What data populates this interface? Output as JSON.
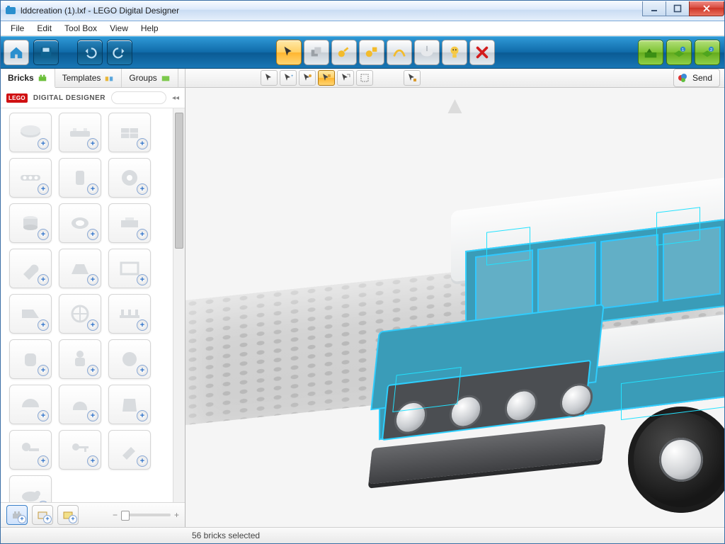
{
  "window": {
    "title": "lddcreation (1).lxf - LEGO Digital Designer"
  },
  "menu": {
    "file": "File",
    "edit": "Edit",
    "toolbox": "Tool Box",
    "view": "View",
    "help": "Help"
  },
  "cmdbar": {
    "home": "home-icon",
    "save": "save-icon",
    "undo": "undo-icon",
    "redo": "redo-icon",
    "tools": [
      "cursor",
      "clone",
      "hinge",
      "hinge-align",
      "flex",
      "paint",
      "hide",
      "delete"
    ],
    "right": [
      "landscape",
      "box-1",
      "box-2"
    ]
  },
  "tabs": {
    "bricks": "Bricks",
    "templates": "Templates",
    "groups": "Groups"
  },
  "subtools": {
    "row1": [
      "select",
      "select-add",
      "select-color",
      "select-connected",
      "select-type",
      "select-all"
    ],
    "row2": [
      "select-invert"
    ]
  },
  "send": {
    "label": "Send"
  },
  "ldd_header": {
    "logo": "LEGO",
    "title": "DIGITAL DESIGNER"
  },
  "bricks_palette": {
    "rows": [
      [
        "plate-round",
        "plate-2x",
        "plate-grid"
      ],
      [
        "technic-beam",
        "technic-pin",
        "gear"
      ],
      [
        "cylinder",
        "tube",
        "plate-mod"
      ],
      [
        "wrench",
        "wedge",
        "frame"
      ],
      [
        "plate-angle",
        "steering-wheel",
        "track"
      ],
      [
        "barrel",
        "minifig",
        "head"
      ],
      [
        "helmet-round",
        "helmet",
        "torso"
      ],
      [
        "handle",
        "key",
        "tool"
      ],
      [
        "animal",
        "",
        ""
      ]
    ]
  },
  "footer_tabs": [
    "brick-view",
    "box-view",
    "set-view"
  ],
  "status": {
    "text": "56 bricks selected"
  },
  "colors": {
    "accent": "#1f7fc0",
    "select": "#22e2ff",
    "bus_body": "#3a9cb8"
  }
}
